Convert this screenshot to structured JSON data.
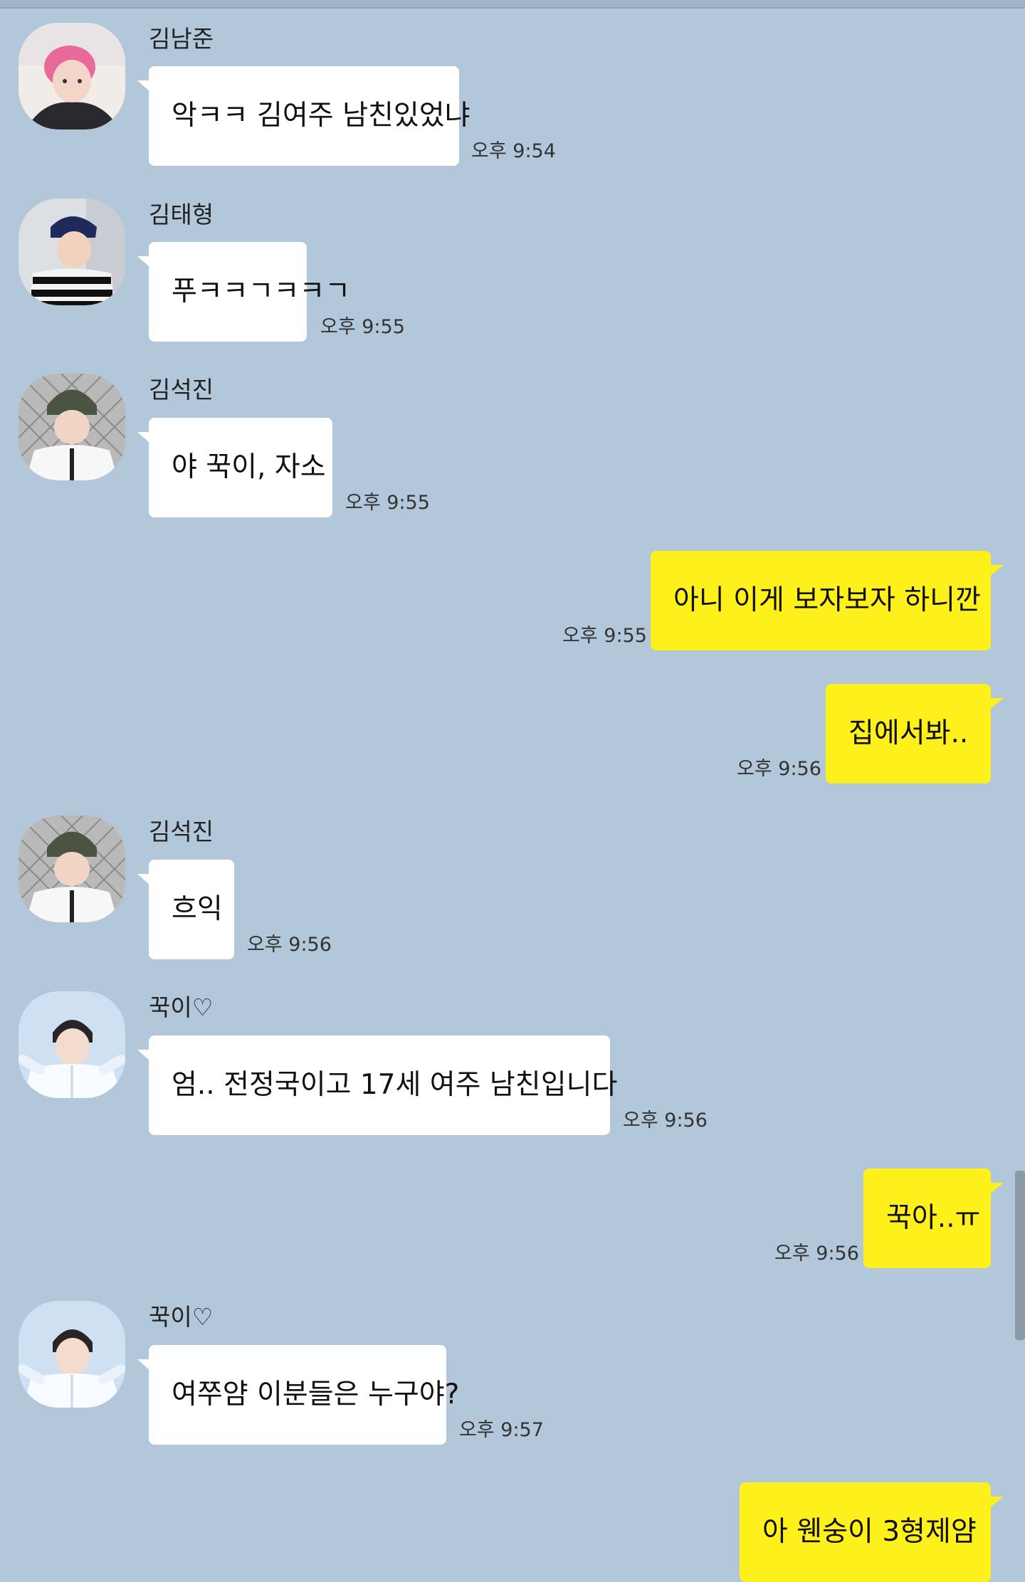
{
  "chat": {
    "messages": [
      {
        "sender": "김남준",
        "text": "악ㅋㅋ 김여주 남친있었냐",
        "time": "오후 9:54",
        "avatar": "namjoon"
      },
      {
        "sender": "김태형",
        "text": "푸ㅋㅋㄱㅋㅋㄱ",
        "time": "오후 9:55",
        "avatar": "taehyung"
      },
      {
        "sender": "김석진",
        "text": "야 꾹이, 자소",
        "time": "오후 9:55",
        "avatar": "seokjin"
      },
      {
        "sender": "",
        "text": "아니 이게 보자보자 하니깐",
        "time": "오후 9:55"
      },
      {
        "sender": "",
        "text": "집에서봐..",
        "time": "오후 9:56"
      },
      {
        "sender": "김석진",
        "text": "흐익",
        "time": "오후 9:56",
        "avatar": "seokjin"
      },
      {
        "sender": "꾹이♡",
        "text": "엄.. 전정국이고 17세 여주 남친입니다",
        "time": "오후 9:56",
        "avatar": "jungkook"
      },
      {
        "sender": "",
        "text": "꾹아..ㅠ",
        "time": "오후 9:56"
      },
      {
        "sender": "꾹이♡",
        "text": "여쭈얌 이분들은 누구야?",
        "time": "오후 9:57",
        "avatar": "jungkook"
      },
      {
        "sender": "",
        "text": "아 웬숭이 3형제얌",
        "time": ""
      }
    ]
  },
  "colors": {
    "background": "#b2c7da",
    "incoming_bubble": "#ffffff",
    "outgoing_bubble": "#fef01b"
  }
}
